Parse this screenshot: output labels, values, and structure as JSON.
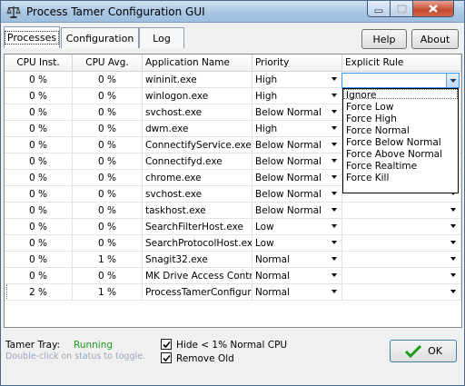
{
  "window": {
    "title": "Process Tamer Configuration GUI"
  },
  "tabs": [
    {
      "label": "Processes",
      "active": true
    },
    {
      "label": "Configuration",
      "active": false
    },
    {
      "label": "Log",
      "active": false
    }
  ],
  "toolbar": {
    "help_label": "Help",
    "about_label": "About"
  },
  "table": {
    "columns": [
      "CPU Inst.",
      "CPU Avg.",
      "Application Name",
      "Priority",
      "Explicit Rule"
    ],
    "rows": [
      {
        "cpu_inst": "0 %",
        "cpu_avg": "0 %",
        "name": "wininit.exe",
        "priority": "High",
        "rule": ""
      },
      {
        "cpu_inst": "0 %",
        "cpu_avg": "0 %",
        "name": "winlogon.exe",
        "priority": "High",
        "rule": ""
      },
      {
        "cpu_inst": "0 %",
        "cpu_avg": "0 %",
        "name": "svchost.exe",
        "priority": "Below Normal",
        "rule": ""
      },
      {
        "cpu_inst": "0 %",
        "cpu_avg": "0 %",
        "name": "dwm.exe",
        "priority": "High",
        "rule": ""
      },
      {
        "cpu_inst": "0 %",
        "cpu_avg": "0 %",
        "name": "ConnectifyService.exe",
        "priority": "Below Normal",
        "rule": ""
      },
      {
        "cpu_inst": "0 %",
        "cpu_avg": "0 %",
        "name": "Connectifyd.exe",
        "priority": "Below Normal",
        "rule": ""
      },
      {
        "cpu_inst": "0 %",
        "cpu_avg": "0 %",
        "name": "chrome.exe",
        "priority": "Below Normal",
        "rule": ""
      },
      {
        "cpu_inst": "0 %",
        "cpu_avg": "0 %",
        "name": "svchost.exe",
        "priority": "Below Normal",
        "rule": ""
      },
      {
        "cpu_inst": "0 %",
        "cpu_avg": "0 %",
        "name": "taskhost.exe",
        "priority": "Below Normal",
        "rule": ""
      },
      {
        "cpu_inst": "0 %",
        "cpu_avg": "0 %",
        "name": "SearchFilterHost.exe",
        "priority": "Low",
        "rule": ""
      },
      {
        "cpu_inst": "0 %",
        "cpu_avg": "0 %",
        "name": "SearchProtocolHost.exe",
        "priority": "Low",
        "rule": ""
      },
      {
        "cpu_inst": "0 %",
        "cpu_avg": "1 %",
        "name": "Snagit32.exe",
        "priority": "Normal",
        "rule": ""
      },
      {
        "cpu_inst": "0 %",
        "cpu_avg": "0 %",
        "name": "MK Drive Access Contro",
        "priority": "Normal",
        "rule": ""
      },
      {
        "cpu_inst": "2 %",
        "cpu_avg": "1 %",
        "name": "ProcessTamerConfigurat",
        "priority": "Normal",
        "rule": ""
      }
    ]
  },
  "rule_dropdown": {
    "options": [
      "Ignore",
      "Force Low",
      "Force High",
      "Force Normal",
      "Force Below Normal",
      "Force Above Normal",
      "Force Realtime",
      "Force Kill"
    ]
  },
  "footer": {
    "tray_label": "Tamer Tray:",
    "tray_status": "Running",
    "tray_hint": "Double-click on status to toggle.",
    "hide_label": "Hide < 1% Normal CPU",
    "hide_checked": true,
    "remove_label": "Remove Old",
    "remove_checked": true,
    "ok_label": "OK"
  },
  "colors": {
    "status_running": "#1a9a1a",
    "hint_gray": "#9aa7b5",
    "ok_check": "#1e9b1e",
    "selection_border": "#3399ff"
  },
  "icons": {
    "app": "scales-icon",
    "ok": "checkmark-icon"
  }
}
